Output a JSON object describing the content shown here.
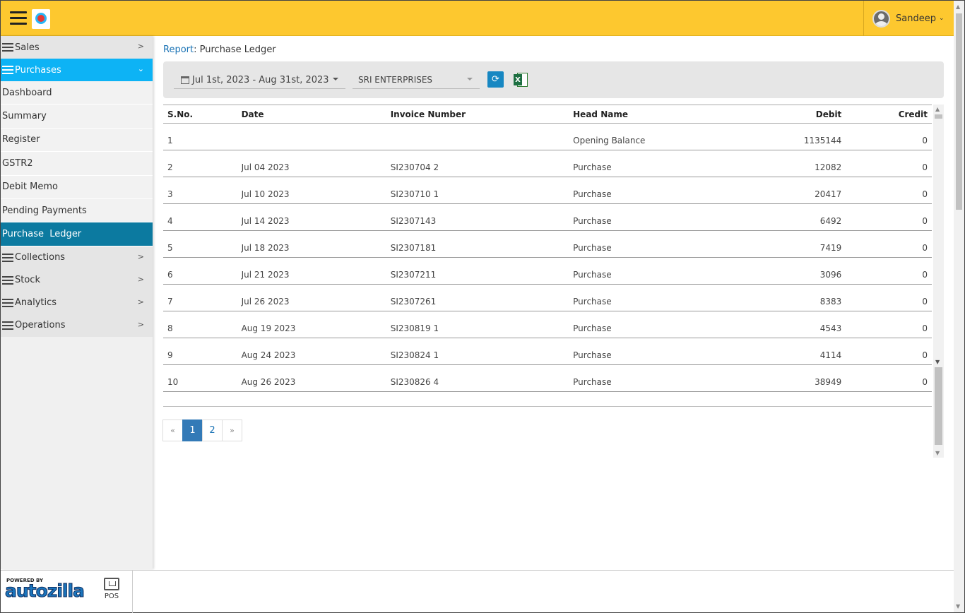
{
  "header": {
    "user_name": "Sandeep"
  },
  "sidebar": {
    "sections": [
      {
        "label": "Sales"
      },
      {
        "label": "Purchases"
      },
      {
        "label": "Collections"
      },
      {
        "label": "Stock"
      },
      {
        "label": "Analytics"
      },
      {
        "label": "Operations"
      }
    ],
    "purchase_items": [
      {
        "label": "Dashboard"
      },
      {
        "label": "Summary"
      },
      {
        "label": "Register"
      },
      {
        "label": "GSTR2"
      },
      {
        "label": "Debit Memo"
      },
      {
        "label": "Pending Payments"
      },
      {
        "label": "Purchase  Ledger"
      }
    ]
  },
  "breadcrumb": {
    "link": "Report",
    "separator": ":",
    "current": " Purchase Ledger"
  },
  "filters": {
    "date_range": "Jul 1st, 2023 - Aug 31st, 2023",
    "party": "SRI ENTERPRISES",
    "refresh_icon": "refresh-icon",
    "excel_icon": "excel-icon"
  },
  "table": {
    "columns": [
      "S.No.",
      "Date",
      "Invoice Number",
      "Head Name",
      "Debit",
      "Credit"
    ],
    "rows": [
      {
        "sno": "1",
        "date": "",
        "invoice": "",
        "head": "Opening Balance",
        "debit": "1135144",
        "credit": "0"
      },
      {
        "sno": "2",
        "date": "Jul 04 2023",
        "invoice": "SI230704 2",
        "head": "Purchase",
        "debit": "12082",
        "credit": "0"
      },
      {
        "sno": "3",
        "date": "Jul 10 2023",
        "invoice": "SI230710 1",
        "head": "Purchase",
        "debit": "20417",
        "credit": "0"
      },
      {
        "sno": "4",
        "date": "Jul 14 2023",
        "invoice": "SI2307143",
        "head": "Purchase",
        "debit": "6492",
        "credit": "0"
      },
      {
        "sno": "5",
        "date": "Jul 18 2023",
        "invoice": "SI2307181",
        "head": "Purchase",
        "debit": "7419",
        "credit": "0"
      },
      {
        "sno": "6",
        "date": "Jul 21 2023",
        "invoice": "SI2307211",
        "head": "Purchase",
        "debit": "3096",
        "credit": "0"
      },
      {
        "sno": "7",
        "date": "Jul 26 2023",
        "invoice": "SI2307261",
        "head": "Purchase",
        "debit": "8383",
        "credit": "0"
      },
      {
        "sno": "8",
        "date": "Aug 19 2023",
        "invoice": "SI230819 1",
        "head": "Purchase",
        "debit": "4543",
        "credit": "0"
      },
      {
        "sno": "9",
        "date": "Aug 24 2023",
        "invoice": "SI230824 1",
        "head": "Purchase",
        "debit": "4114",
        "credit": "0"
      },
      {
        "sno": "10",
        "date": "Aug 26 2023",
        "invoice": "SI230826 4",
        "head": "Purchase",
        "debit": "38949",
        "credit": "0"
      }
    ]
  },
  "pagination": {
    "prev": "«",
    "pages": [
      "1",
      "2"
    ],
    "next": "»",
    "current": "1"
  },
  "footer": {
    "powered_by": "POWERED BY",
    "brand": "autozilla",
    "pos_label": "POS"
  },
  "colors": {
    "header_bg": "#fdc82f",
    "active_section": "#0db3f5",
    "active_item": "#0c7aa0",
    "link": "#1a73b5"
  }
}
